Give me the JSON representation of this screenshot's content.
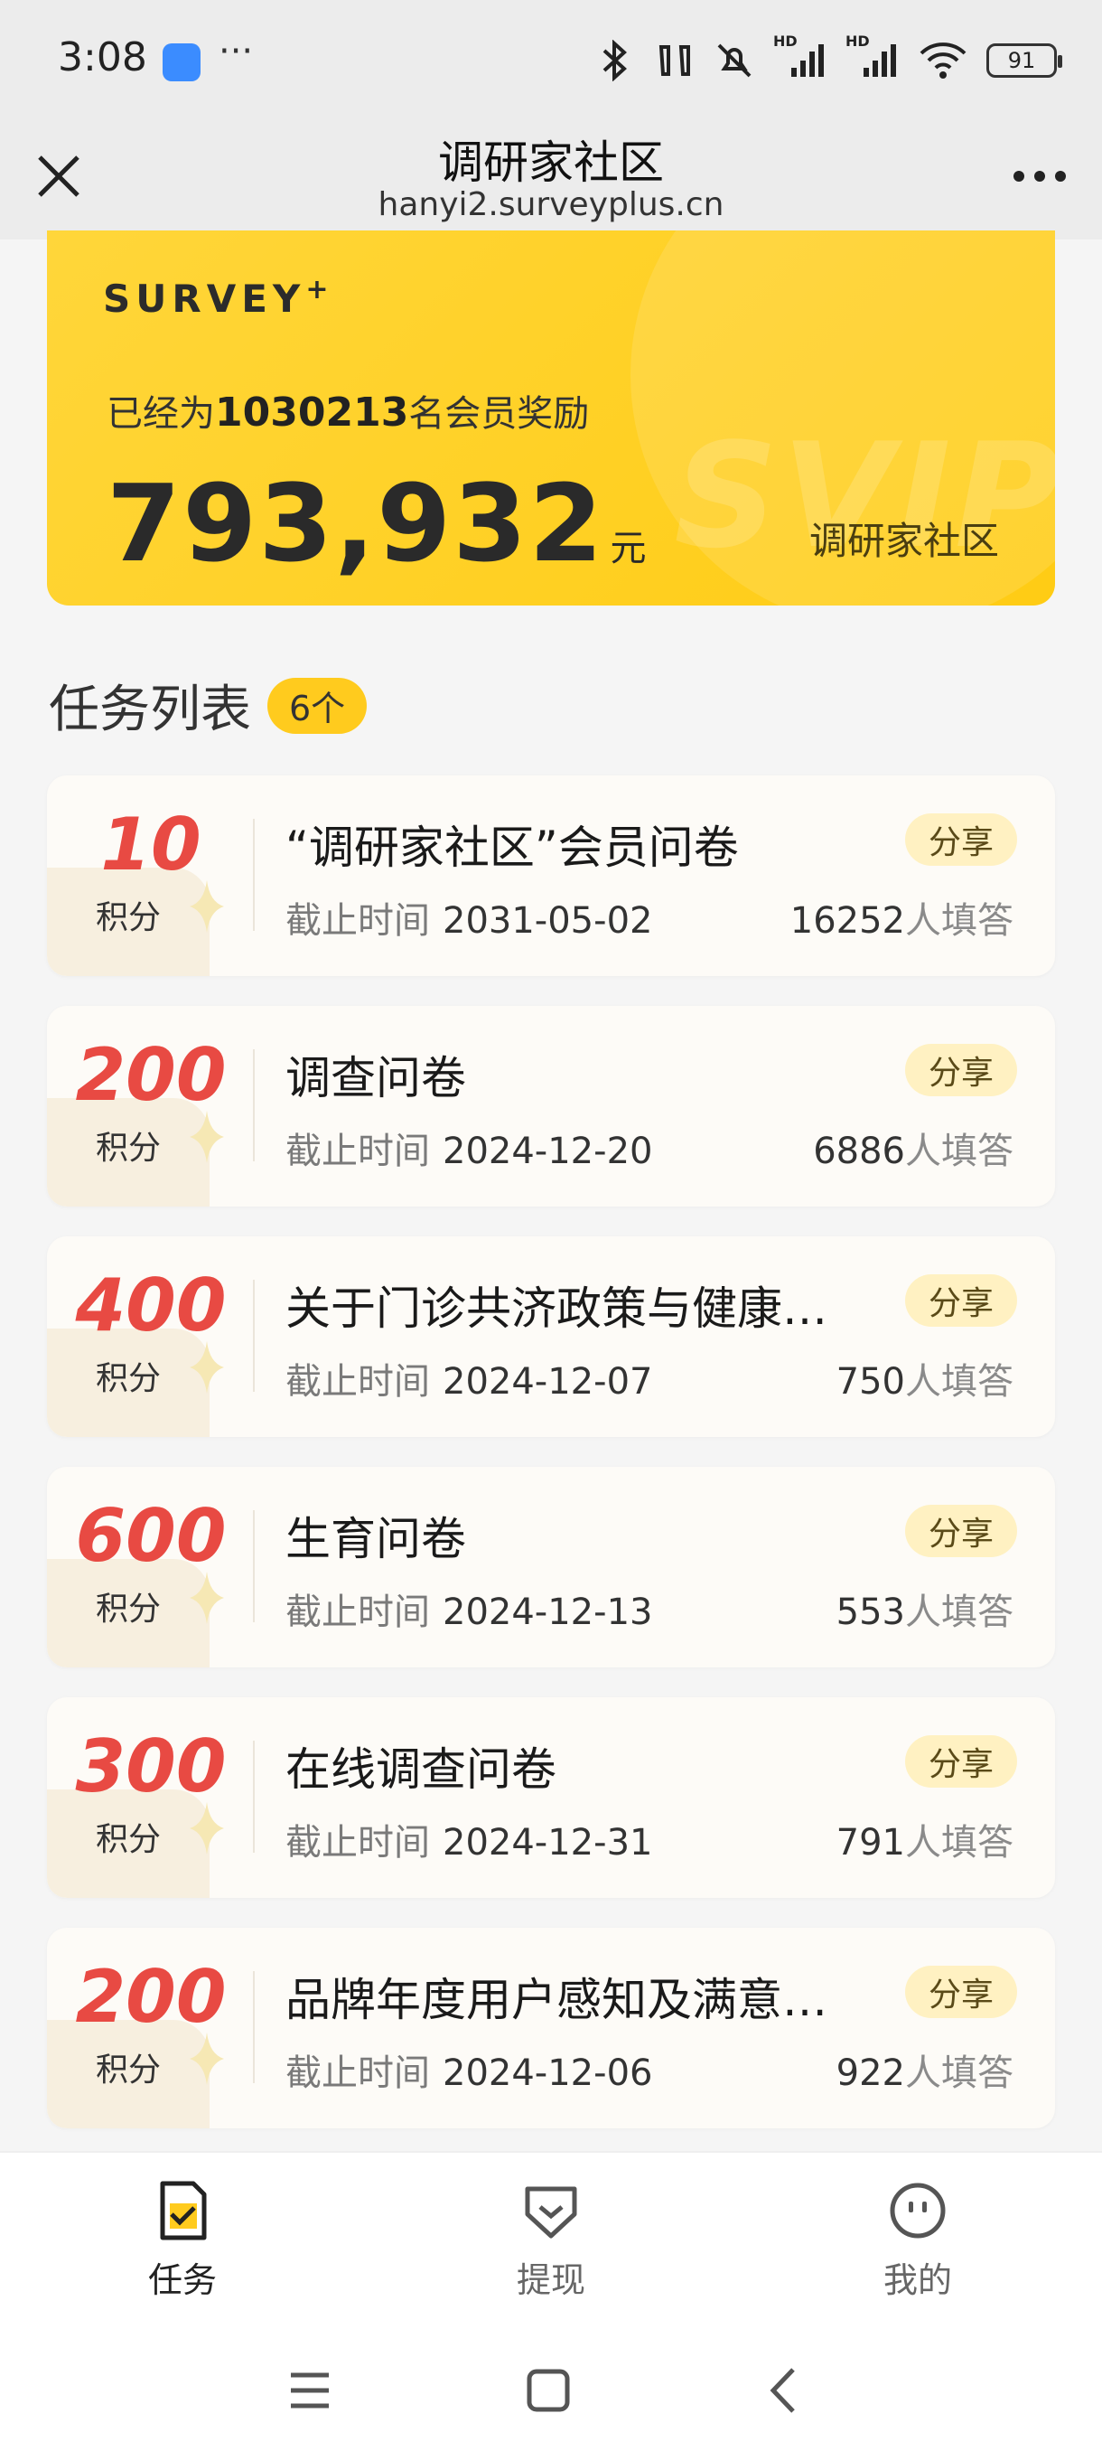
{
  "status": {
    "time": "3:08",
    "more": "···",
    "battery": "91",
    "hd1": "HD",
    "hd2": "HD"
  },
  "header": {
    "title": "调研家社区",
    "url": "hanyi2.surveyplus.cn"
  },
  "banner": {
    "logo": "SURVEY",
    "logo_mark": "+",
    "stats_prefix": "已经为",
    "member_count": "1030213",
    "stats_suffix": "名会员奖励",
    "amount": "793,932",
    "unit": "元",
    "community": "调研家社区",
    "watermark": "SVIP"
  },
  "task_list": {
    "title": "任务列表",
    "count": "6个",
    "deadline_label": "截止时间",
    "points_unit": "积分",
    "share_label": "分享",
    "respondents_suffix": "人填答",
    "items": [
      {
        "points": "10",
        "title": "“调研家社区”会员问卷",
        "deadline": "2031-05-02",
        "respondents": "16252"
      },
      {
        "points": "200",
        "title": "调查问卷",
        "deadline": "2024-12-20",
        "respondents": "6886"
      },
      {
        "points": "400",
        "title": "关于门诊共济政策与健康…",
        "deadline": "2024-12-07",
        "respondents": "750"
      },
      {
        "points": "600",
        "title": "生育问卷",
        "deadline": "2024-12-13",
        "respondents": "553"
      },
      {
        "points": "300",
        "title": "在线调查问卷",
        "deadline": "2024-12-31",
        "respondents": "791"
      },
      {
        "points": "200",
        "title": "品牌年度用户感知及满意…",
        "deadline": "2024-12-06",
        "respondents": "922"
      }
    ]
  },
  "tabs": [
    {
      "label": "任务"
    },
    {
      "label": "提现"
    },
    {
      "label": "我的"
    }
  ],
  "colors": {
    "accent_yellow": "#ffcc14",
    "points_red": "#e84a43",
    "share_bg": "#fff1c2"
  }
}
